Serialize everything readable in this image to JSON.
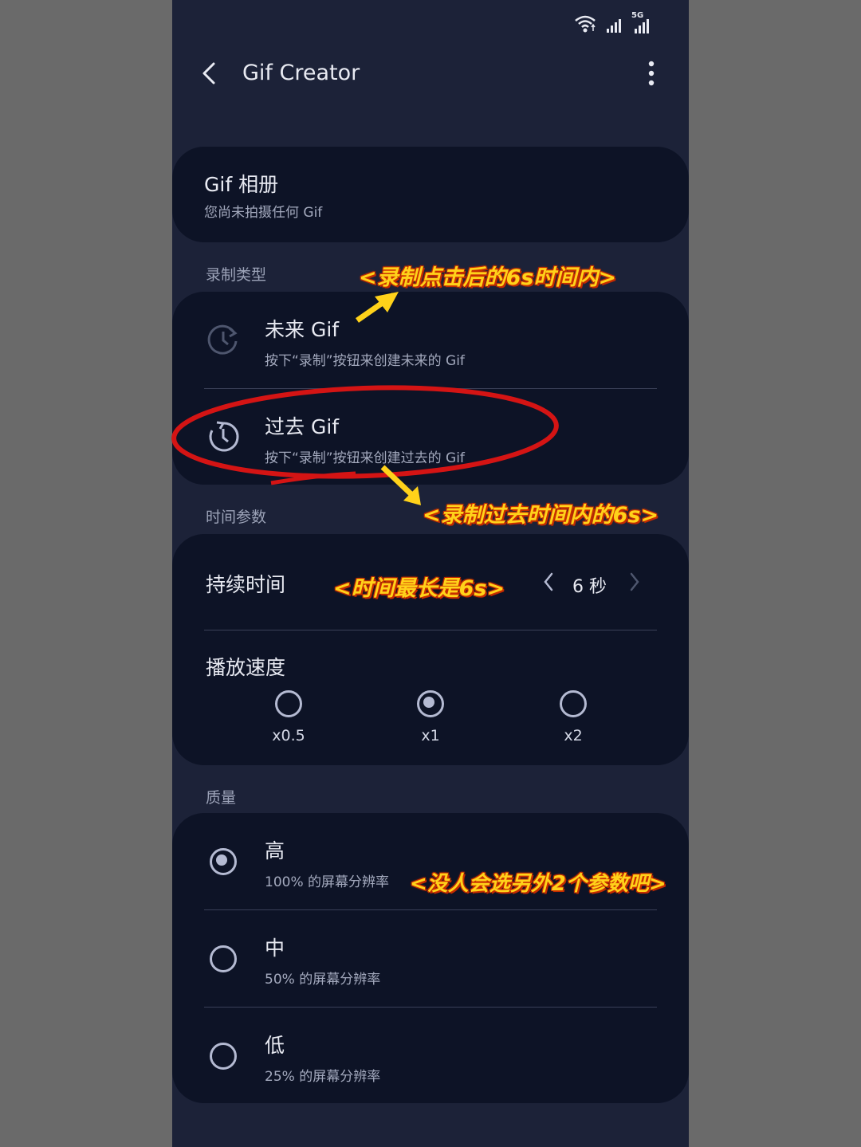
{
  "status_bar": {
    "network": "5G"
  },
  "appbar": {
    "title": "Gif Creator"
  },
  "gallery": {
    "title": "Gif 相册",
    "subtitle": "您尚未拍摄任何 Gif"
  },
  "record_type": {
    "label": "录制类型",
    "options": [
      {
        "title": "未来 Gif",
        "subtitle": "按下“录制”按钮来创建未来的 Gif"
      },
      {
        "title": "过去 Gif",
        "subtitle": "按下“录制”按钮来创建过去的 Gif"
      }
    ]
  },
  "time_params": {
    "label": "时间参数",
    "duration": {
      "label": "持续时间",
      "value": "6 秒"
    },
    "speed": {
      "label": "播放速度",
      "options": [
        "x0.5",
        "x1",
        "x2"
      ],
      "selected": "x1"
    }
  },
  "quality": {
    "label": "质量",
    "options": [
      {
        "title": "高",
        "subtitle": "100% 的屏幕分辨率"
      },
      {
        "title": "中",
        "subtitle": "50% 的屏幕分辨率"
      },
      {
        "title": "低",
        "subtitle": "25% 的屏幕分辨率"
      }
    ],
    "selected": "高"
  },
  "annotations": {
    "future": "<录制点击后的6s时间内>",
    "past": "<录制过去时间内的6s>",
    "duration": "<时间最长是6s>",
    "quality": "<没人会选另外2个参数吧>"
  },
  "colors": {
    "background": "#1c2238",
    "card": "#0d1326",
    "annotation_text": "#ffd21a",
    "annotation_circle": "#d41414"
  },
  "icons": [
    "wifi-icon",
    "signal-icon",
    "back-arrow-icon",
    "more-vert-icon",
    "clock-forward-icon",
    "clock-history-icon",
    "chevron-left-icon",
    "chevron-right-icon"
  ]
}
